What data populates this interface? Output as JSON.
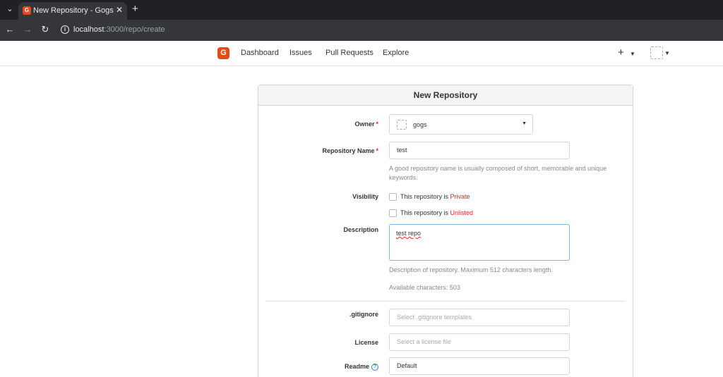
{
  "browser": {
    "tab_title": "New Repository - Gogs",
    "url_host": "localhost",
    "url_path": ":3000/repo/create"
  },
  "nav": {
    "dashboard": "Dashboard",
    "issues": "Issues",
    "pull_requests": "Pull Requests",
    "explore": "Explore"
  },
  "form": {
    "title": "New Repository",
    "owner_label": "Owner",
    "owner_value": "gogs",
    "repo_name_label": "Repository Name",
    "repo_name_value": "test",
    "repo_name_help": "A good repository name is usually composed of short, memorable and unique keywords.",
    "visibility_label": "Visibility",
    "private_prefix": "This repository is ",
    "private_word": "Private",
    "private_checked": false,
    "unlisted_prefix": "This repository is ",
    "unlisted_word": "Unlisted",
    "unlisted_checked": false,
    "description_label": "Description",
    "description_value": "test repo",
    "description_help": "Description of repository. Maximum 512 characters length.",
    "available_chars": "Available characters: 503",
    "gitignore_label": ".gitignore",
    "gitignore_placeholder": "Select .gitignore templates",
    "license_label": "License",
    "license_placeholder": "Select a license file",
    "readme_label": "Readme",
    "readme_value": "Default"
  },
  "colors": {
    "brand": "#e64a19",
    "required": "#db2828",
    "focus_border": "#85b7d9"
  }
}
